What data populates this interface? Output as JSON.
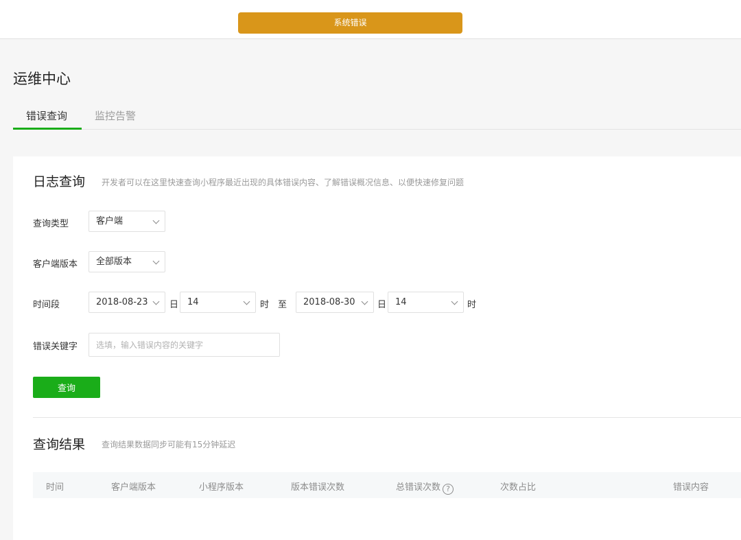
{
  "banner": {
    "text": "系统错误"
  },
  "page": {
    "title": "运维中心"
  },
  "tabs": [
    {
      "label": "错误查询",
      "active": true
    },
    {
      "label": "监控告警",
      "active": false
    }
  ],
  "log_query": {
    "title": "日志查询",
    "description": "开发者可以在这里快速查询小程序最近出现的具体错误内容、了解错误概况信息、以便快速修复问题",
    "query_type": {
      "label": "查询类型",
      "value": "客户端"
    },
    "client_version": {
      "label": "客户端版本",
      "value": "全部版本"
    },
    "time_range": {
      "label": "时间段",
      "start_date": "2018-08-23",
      "start_hour": "14",
      "end_date": "2018-08-30",
      "end_hour": "14",
      "day_unit": "日",
      "hour_unit": "时",
      "to": "至"
    },
    "keyword": {
      "label": "错误关键字",
      "placeholder": "选填，输入错误内容的关键字"
    },
    "query_button": "查询"
  },
  "results": {
    "title": "查询结果",
    "description": "查询结果数据同步可能有15分钟延迟",
    "columns": [
      "时间",
      "客户端版本",
      "小程序版本",
      "版本错误次数",
      "总错误次数",
      "次数占比",
      "错误内容"
    ],
    "rows": []
  },
  "colors": {
    "accent": "#1aad19",
    "banner": "#d9961a"
  }
}
